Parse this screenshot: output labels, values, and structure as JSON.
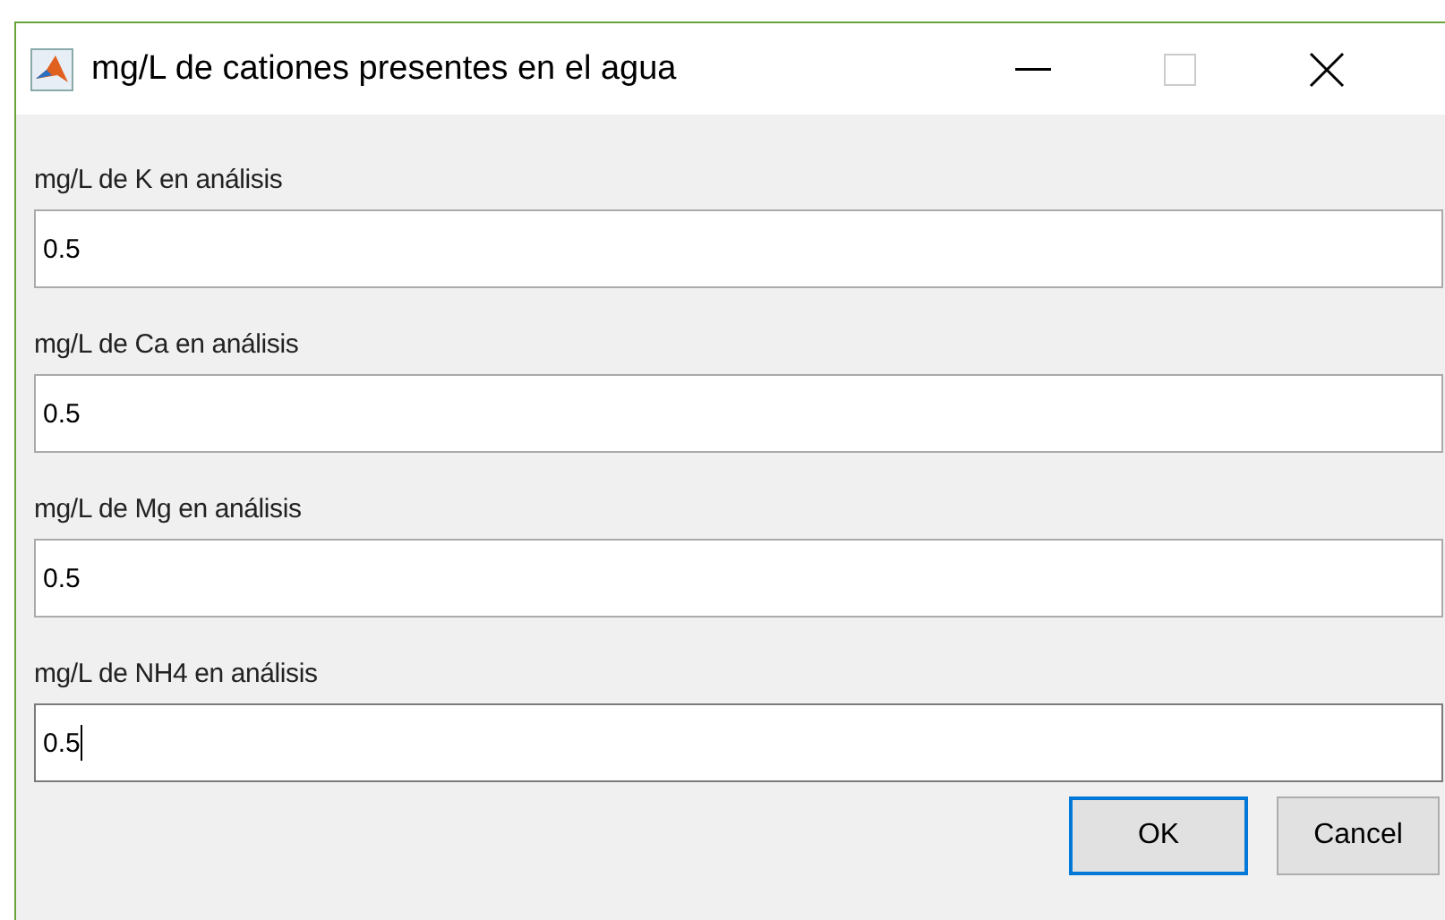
{
  "window": {
    "title": "mg/L de cationes presentes en el agua"
  },
  "fields": [
    {
      "label": "mg/L de K en análisis",
      "value": "0.5",
      "focused": false
    },
    {
      "label": "mg/L de Ca en análisis",
      "value": "0.5",
      "focused": false
    },
    {
      "label": "mg/L de Mg en análisis",
      "value": "0.5",
      "focused": false
    },
    {
      "label": "mg/L de NH4 en análisis",
      "value": "0.5",
      "focused": true
    }
  ],
  "buttons": [
    {
      "label": "OK",
      "default": true
    },
    {
      "label": "Cancel",
      "default": false
    }
  ]
}
